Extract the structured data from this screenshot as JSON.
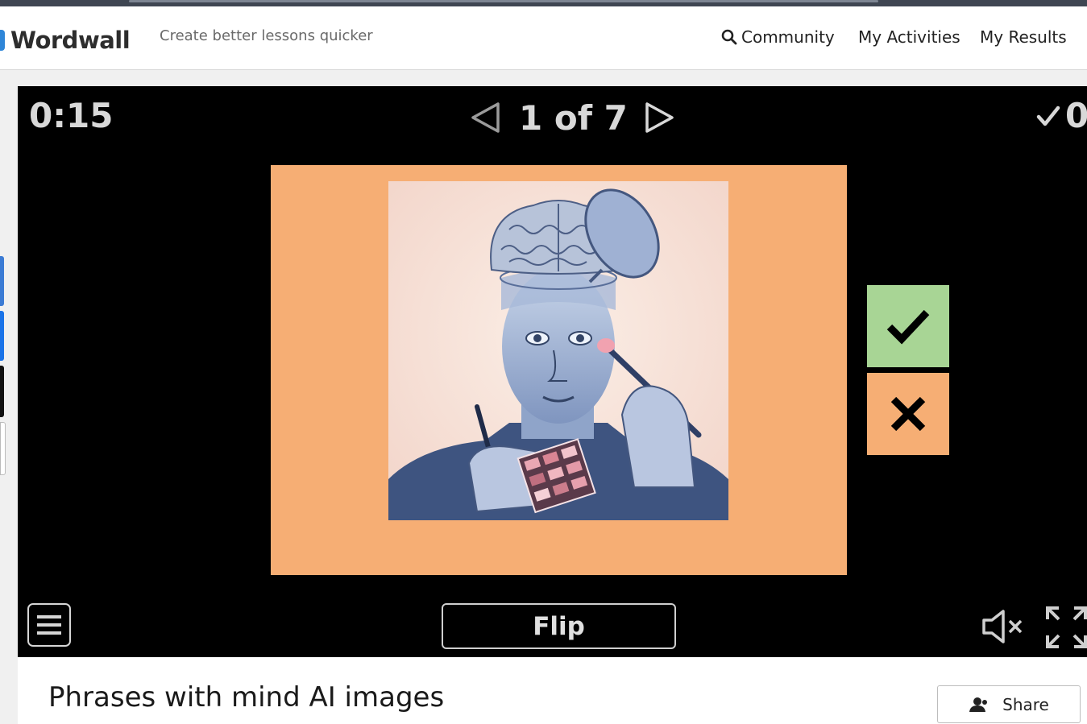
{
  "header": {
    "logo_text": "Wordwall",
    "tagline": "Create better lessons quicker",
    "nav": {
      "community": "Community",
      "my_activities": "My Activities",
      "my_results": "My Results"
    }
  },
  "game": {
    "timer": "0:15",
    "pager": "1 of 7",
    "score": "0",
    "flip_label": "Flip",
    "card_icons": {
      "image": "brain-makeup-illustration",
      "correct": "check-icon",
      "wrong": "cross-icon"
    }
  },
  "footer": {
    "title": "Phrases with mind AI images",
    "share_label": "Share"
  },
  "colors": {
    "card": "#f6ae74",
    "correct": "#a8d595",
    "wrong": "#f6ae74",
    "game_bg": "#000000"
  }
}
